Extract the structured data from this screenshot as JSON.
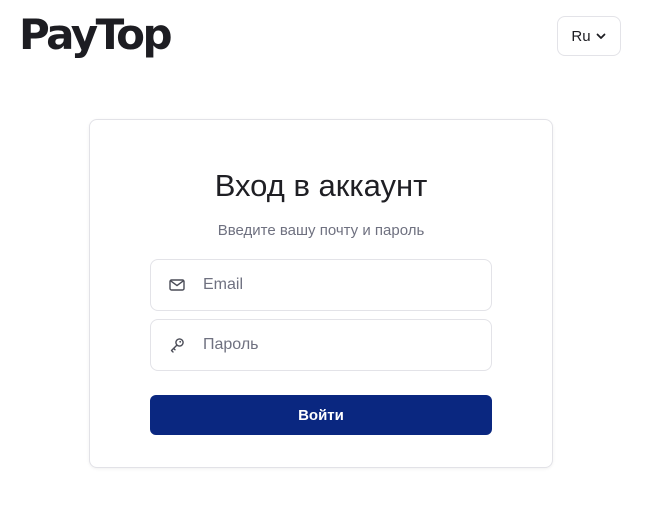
{
  "header": {
    "logo_text": "PayTop",
    "language": {
      "label": "Ru",
      "icon": "chevron-down-icon"
    }
  },
  "login": {
    "title": "Вход в аккаунт",
    "subtitle": "Введите вашу почту и пароль",
    "email": {
      "value": "",
      "placeholder": "Email",
      "icon": "mail-icon"
    },
    "password": {
      "value": "",
      "placeholder": "Пароль",
      "icon": "key-icon"
    },
    "submit_label": "Войти"
  },
  "colors": {
    "primary_button": "#0a2780",
    "text_dark": "#1f1f24",
    "text_muted": "#6f7180",
    "border": "#e3e3e8"
  }
}
